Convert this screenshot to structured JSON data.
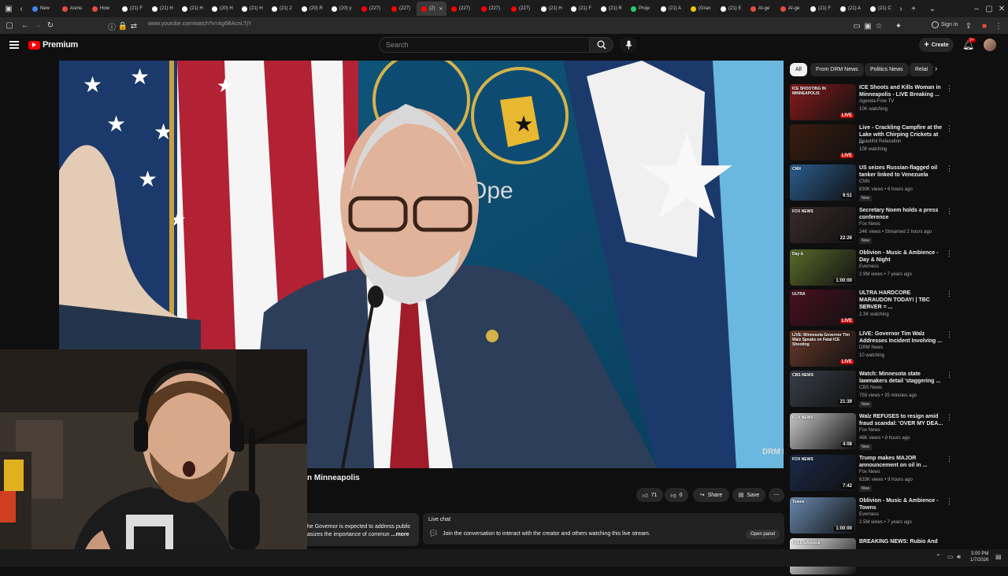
{
  "browser": {
    "tabs": [
      {
        "label": "New",
        "color": "#4285f4"
      },
      {
        "label": "Asmo",
        "color": "#e74c3c"
      },
      {
        "label": "How",
        "color": "#e74c3c"
      },
      {
        "label": "(21) F",
        "color": "#ffffff"
      },
      {
        "label": "(21) H",
        "color": "#ffffff"
      },
      {
        "label": "(21) H",
        "color": "#ffffff"
      },
      {
        "label": "(20) H",
        "color": "#ffffff"
      },
      {
        "label": "(21) H",
        "color": "#ffffff"
      },
      {
        "label": "(21) 2",
        "color": "#ffffff"
      },
      {
        "label": "(20) R",
        "color": "#ffffff"
      },
      {
        "label": "(20) y",
        "color": "#ffffff"
      },
      {
        "label": "(227)",
        "color": "#ff0000"
      },
      {
        "label": "(227)",
        "color": "#ff0000"
      },
      {
        "label": "(2)",
        "color": "#ff0000",
        "active": true
      },
      {
        "label": "(227)",
        "color": "#ff0000"
      },
      {
        "label": "(227)",
        "color": "#ff0000"
      },
      {
        "label": "(227)",
        "color": "#ff0000"
      },
      {
        "label": "(21) H",
        "color": "#ffffff"
      },
      {
        "label": "(21) F",
        "color": "#ffffff"
      },
      {
        "label": "(21) R",
        "color": "#ffffff"
      },
      {
        "label": "Proje",
        "color": "#2ecc71"
      },
      {
        "label": "(21) A",
        "color": "#ffffff"
      },
      {
        "label": "(Gran",
        "color": "#f1c40f"
      },
      {
        "label": "(21) E",
        "color": "#ffffff"
      },
      {
        "label": "AI-ge",
        "color": "#e74c3c"
      },
      {
        "label": "AI-ge",
        "color": "#e74c3c"
      },
      {
        "label": "(21) F",
        "color": "#ffffff"
      },
      {
        "label": "(21) A",
        "color": "#ffffff"
      },
      {
        "label": "(21) C",
        "color": "#ffffff"
      }
    ],
    "url": "www.youtube.com/watch?v=Ag6BAcnLTjY"
  },
  "header": {
    "logo_label": "Premium",
    "search_placeholder": "Search",
    "create_label": "Create",
    "notification_count": "9+",
    "sign_in_label": "Sign in"
  },
  "video": {
    "title_visible": "n Minneapolis",
    "likes": "71",
    "dislikes": "0",
    "share_label": "Share",
    "save_label": "Save",
    "description_line1": "he Governor is expected to address public",
    "description_line2": "asizes the importance of commun",
    "more_label": "...more",
    "watermark": "DRM NEWS",
    "seal_text": "Ope"
  },
  "live_chat": {
    "label": "Live chat",
    "message": "Join the conversation to interact with the creator and others watching this live stream.",
    "open_panel_label": "Open panel"
  },
  "chips": [
    {
      "label": "All",
      "active": true
    },
    {
      "label": "From DRM News",
      "active": false
    },
    {
      "label": "Politics News",
      "active": false
    },
    {
      "label": "Relat",
      "active": false
    }
  ],
  "recommendations": [
    {
      "title": "ICE Shoots and Kills Woman in Minneapolis - LIVE Breaking ...",
      "channel": "Agenda-Free TV",
      "meta": "10K watching",
      "badge": "LIVE",
      "badge_type": "live",
      "new": false,
      "thumb_color": "#8a1a1a",
      "thumb_text": "ICE SHOOTING IN MINNEAPOLIS"
    },
    {
      "title": "Live - Crackling Campfire at the Lake with Chirping Crickets at ...",
      "channel": "Beautiful Relaxation",
      "meta": "108 watching",
      "badge": "LIVE",
      "badge_type": "live",
      "new": false,
      "thumb_color": "#3b1c0e",
      "thumb_text": ""
    },
    {
      "title": "US seizes Russian-flagged oil tanker linked to Venezuela",
      "channel": "CNN",
      "meta": "630K views • 6 hours ago",
      "badge": "9:51",
      "badge_type": "time",
      "new": true,
      "thumb_color": "#2a5d8f",
      "thumb_text": "CNN"
    },
    {
      "title": "Secretary Noem holds a press conference",
      "channel": "Fox News",
      "meta": "24K views • Streamed 2 hours ago",
      "badge": "22:26",
      "badge_type": "time",
      "new": true,
      "thumb_color": "#3a2a2a",
      "thumb_text": "FOX NEWS"
    },
    {
      "title": "Oblivion - Music & Ambience - Day & Night",
      "channel": "Everness",
      "meta": "2.9M views • 7 years ago",
      "badge": "1:00:00",
      "badge_type": "time",
      "new": false,
      "thumb_color": "#5a6b2a",
      "thumb_text": "Day &"
    },
    {
      "title": "ULTRA HARDCORE MARAUDON TODAY! | TBC SERVER = ...",
      "channel": "Xaryu",
      "meta": "2.3K watching",
      "badge": "LIVE",
      "badge_type": "live",
      "new": false,
      "thumb_color": "#4a1020",
      "thumb_text": "ULTRA"
    },
    {
      "title": "LIVE: Governor Tim Walz Addresses Incident Involving ...",
      "channel": "DRM News",
      "meta": "10 watching",
      "badge": "LIVE",
      "badge_type": "live",
      "new": false,
      "thumb_color": "#6a3a2a",
      "thumb_text": "LIVE: Minnesota Governor Tim Walz Speaks on Fatal ICE Shooting"
    },
    {
      "title": "Watch: Minnesota state lawmakers detail 'staggering ...",
      "channel": "CBS News",
      "meta": "759 views • 35 minutes ago",
      "badge": "21:39",
      "badge_type": "time",
      "new": true,
      "thumb_color": "#3a3f4a",
      "thumb_text": "CBS NEWS"
    },
    {
      "title": "Walz REFUSES to resign amid fraud scandal: 'OVER MY DEA...",
      "channel": "Fox News",
      "meta": "48K views • 8 hours ago",
      "badge": "4:08",
      "badge_type": "time",
      "new": true,
      "thumb_color": "#c8c8c8",
      "thumb_text": "FOX NEWS"
    },
    {
      "title": "Trump makes MAJOR announcement on oil in ...",
      "channel": "Fox News",
      "meta": "633K views • 9 hours ago",
      "badge": "7:42",
      "badge_type": "time",
      "new": true,
      "thumb_color": "#1a2a4a",
      "thumb_text": "FOX NEWS"
    },
    {
      "title": "Oblivion - Music & Ambience - Towns",
      "channel": "Everness",
      "meta": "2.5M views • 7 years ago",
      "badge": "1:00:00",
      "badge_type": "time",
      "new": false,
      "thumb_color": "#6a8ab0",
      "thumb_text": "Towns"
    },
    {
      "title": "BREAKING NEWS: Rubio And",
      "channel": "",
      "meta": "",
      "badge": "",
      "badge_type": "none",
      "new": false,
      "thumb_color": "#f0f0f0",
      "thumb_text": "FULL GAGGLE"
    }
  ],
  "new_label": "New",
  "taskbar": {
    "time": "3:00 PM",
    "date": "1/7/2026"
  },
  "colors": {
    "youtube_red": "#ff0000",
    "live_red": "#cc0000",
    "flag_blue": "#1b3a6b",
    "sky_blue": "#5ab0d8"
  }
}
